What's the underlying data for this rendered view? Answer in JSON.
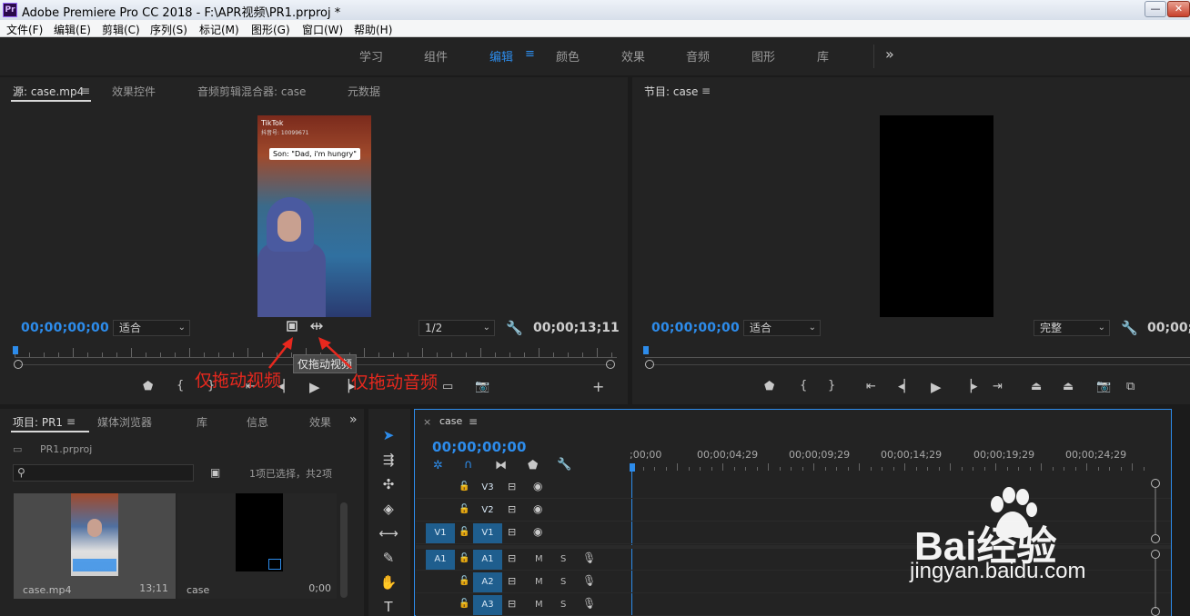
{
  "titlebar": {
    "logo": "Pr",
    "title": "Adobe Premiere Pro CC 2018 - F:\\APR视频\\PR1.prproj *",
    "min": "—",
    "max": "□",
    "close": "✕"
  },
  "menubar": {
    "items": [
      "文件(F)",
      "编辑(E)",
      "剪辑(C)",
      "序列(S)",
      "标记(M)",
      "图形(G)",
      "窗口(W)",
      "帮助(H)"
    ]
  },
  "workspace": {
    "tabs": [
      "学习",
      "组件",
      "编辑",
      "颜色",
      "效果",
      "音频",
      "图形",
      "库"
    ],
    "active": "编辑",
    "more": "»"
  },
  "source_panel": {
    "tabs": [
      "源: case.mp4",
      "效果控件",
      "音频剪辑混合器: case",
      "元数据"
    ],
    "timecode": "00;00;00;00",
    "fit": "适合",
    "resolution": "1/2",
    "duration": "00;00;13;11",
    "video_caption": "Son: \"Dad, i'm hungry\"",
    "video_brand": "TikTok",
    "video_handle": "抖音号: 10099671",
    "tooltip": "仅拖动视频"
  },
  "program_panel": {
    "tab": "节目: case",
    "timecode": "00;00;00;00",
    "fit": "适合",
    "quality": "完整",
    "duration": "00;00;"
  },
  "annotations": {
    "video_only": "仅拖动视频",
    "audio_only": "仅拖动音频"
  },
  "project_panel": {
    "tabs": [
      "项目: PR1",
      "媒体浏览器",
      "库",
      "信息",
      "效果"
    ],
    "more": "»",
    "project_file": "PR1.prproj",
    "selection_info": "1项已选择，共2项",
    "items": [
      {
        "name": "case.mp4",
        "duration": "13;11"
      },
      {
        "name": "case",
        "duration": "0;00"
      }
    ]
  },
  "timeline": {
    "tab": "case",
    "timecode": "00;00;00;00",
    "ruler": [
      ";00;00",
      "00;00;04;29",
      "00;00;09;29",
      "00;00;14;29",
      "00;00;19;29",
      "00;00;24;29"
    ],
    "tracks": [
      {
        "id": "V3",
        "kind": "video"
      },
      {
        "id": "V2",
        "kind": "video"
      },
      {
        "id": "V1",
        "kind": "video",
        "source": "V1"
      },
      {
        "id": "A1",
        "kind": "audio",
        "source": "A1"
      },
      {
        "id": "A2",
        "kind": "audio"
      },
      {
        "id": "A3",
        "kind": "audio"
      }
    ],
    "m_label": "M",
    "s_label": "S"
  },
  "watermark": {
    "brand": "Bai经验",
    "url": "jingyan.baidu.com"
  }
}
